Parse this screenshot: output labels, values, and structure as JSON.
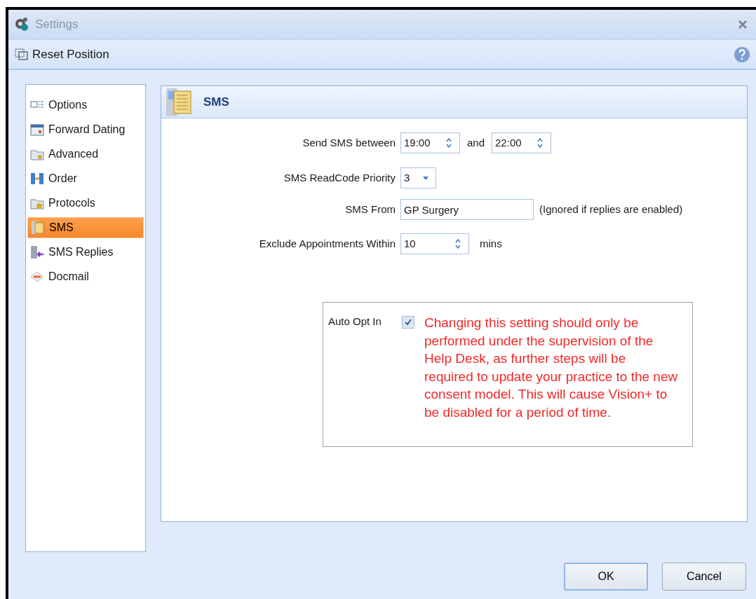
{
  "window": {
    "title": "Settings"
  },
  "toolbar": {
    "reset_button": "Reset Position"
  },
  "sidebar": {
    "items": [
      {
        "label": "Options",
        "selected": false
      },
      {
        "label": "Forward Dating",
        "selected": false
      },
      {
        "label": "Advanced",
        "selected": false
      },
      {
        "label": "Order",
        "selected": false
      },
      {
        "label": "Protocols",
        "selected": false
      },
      {
        "label": "SMS",
        "selected": true
      },
      {
        "label": "SMS Replies",
        "selected": false
      },
      {
        "label": "Docmail",
        "selected": false
      }
    ]
  },
  "panel": {
    "title": "SMS",
    "send_between": {
      "label": "Send SMS between",
      "from": "19:00",
      "joiner": "and",
      "to": "22:00"
    },
    "priority": {
      "label": "SMS ReadCode Priority",
      "value": "3"
    },
    "sms_from": {
      "label": "SMS From",
      "value": "GP Surgery",
      "note": "(Ignored if replies are enabled)"
    },
    "exclude": {
      "label": "Exclude Appointments Within",
      "value": "10",
      "unit": "mins"
    },
    "auto_opt_in": {
      "label": "Auto Opt In",
      "checked": true,
      "warning": "Changing this setting should only be performed under the supervision of the Help Desk, as further steps will be required to update your practice to the new consent model. This will cause Vision+ to be disabled for a period of time."
    }
  },
  "buttons": [
    "OK",
    "Cancel"
  ]
}
